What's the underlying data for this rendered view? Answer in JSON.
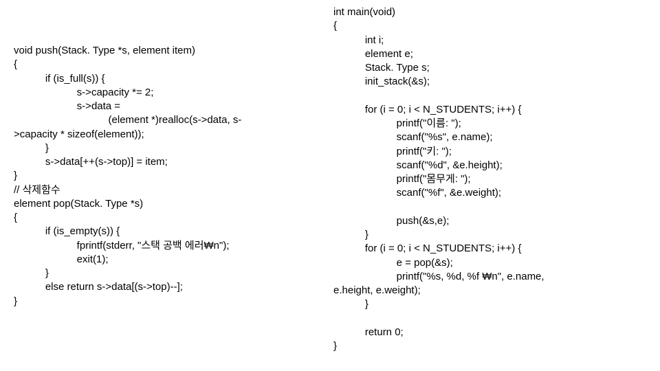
{
  "left_code": "void push(Stack. Type *s, element item)\n{\n           if (is_full(s)) {\n                      s->capacity *= 2;\n                      s->data =\n                                 (element *)realloc(s->data, s-\n>capacity * sizeof(element));\n           }\n           s->data[++(s->top)] = item;\n}\n// 삭제함수\nelement pop(Stack. Type *s)\n{\n           if (is_empty(s)) {\n                      fprintf(stderr, \"스택 공백 에러₩n\");\n                      exit(1);\n           }\n           else return s->data[(s->top)--];\n}",
  "right_code": "int main(void)\n{\n           int i;\n           element e;\n           Stack. Type s;\n           init_stack(&s);\n\n           for (i = 0; i < N_STUDENTS; i++) {\n                      printf(\"이름: \");\n                      scanf(\"%s\", e.name);\n                      printf(\"키: \");\n                      scanf(\"%d\", &e.height);\n                      printf(\"몸무게: \");\n                      scanf(\"%f\", &e.weight);\n\n                      push(&s,e);\n           }\n           for (i = 0; i < N_STUDENTS; i++) {\n                      e = pop(&s);\n                      printf(\"%s, %d, %f ₩n\", e.name,\ne.height, e.weight);\n           }\n\n           return 0;\n}"
}
